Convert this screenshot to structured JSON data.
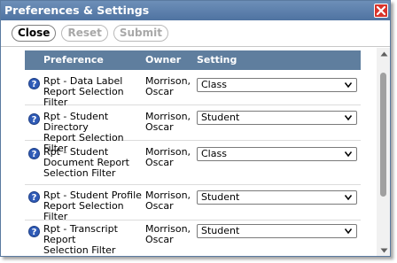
{
  "window": {
    "title": "Preferences & Settings"
  },
  "toolbar": {
    "close_label": "Close",
    "reset_label": "Reset",
    "submit_label": "Submit"
  },
  "table": {
    "headers": {
      "preference": "Preference",
      "owner": "Owner",
      "setting": "Setting"
    },
    "rows": [
      {
        "preference": [
          "Rpt - Data Label",
          "Report Selection Filter"
        ],
        "owner": [
          "Morrison,",
          "Oscar"
        ],
        "setting": "Class"
      },
      {
        "preference": [
          "Rpt - Student Directory",
          "Report Selection Filter"
        ],
        "owner": [
          "Morrison,",
          "Oscar"
        ],
        "setting": "Student"
      },
      {
        "preference": [
          "Rpt - Student",
          "Document Report",
          "Selection Filter"
        ],
        "owner": [
          "Morrison,",
          "Oscar"
        ],
        "setting": "Class"
      },
      {
        "preference": [
          "Rpt - Student Profile",
          "Report Selection Filter"
        ],
        "owner": [
          "Morrison,",
          "Oscar"
        ],
        "setting": "Student"
      },
      {
        "preference": [
          "Rpt - Transcript Report",
          "Selection Filter"
        ],
        "owner": [
          "Morrison,",
          "Oscar"
        ],
        "setting": "Student"
      }
    ]
  },
  "icons": {
    "help": "help-question-icon",
    "close": "close-x-icon",
    "dropdown": "chevron-down-icon"
  },
  "colors": {
    "titlebar": "#5a7ba6",
    "header": "#5f7e9e",
    "help": "#2f5bb7",
    "close": "#d9342b"
  }
}
